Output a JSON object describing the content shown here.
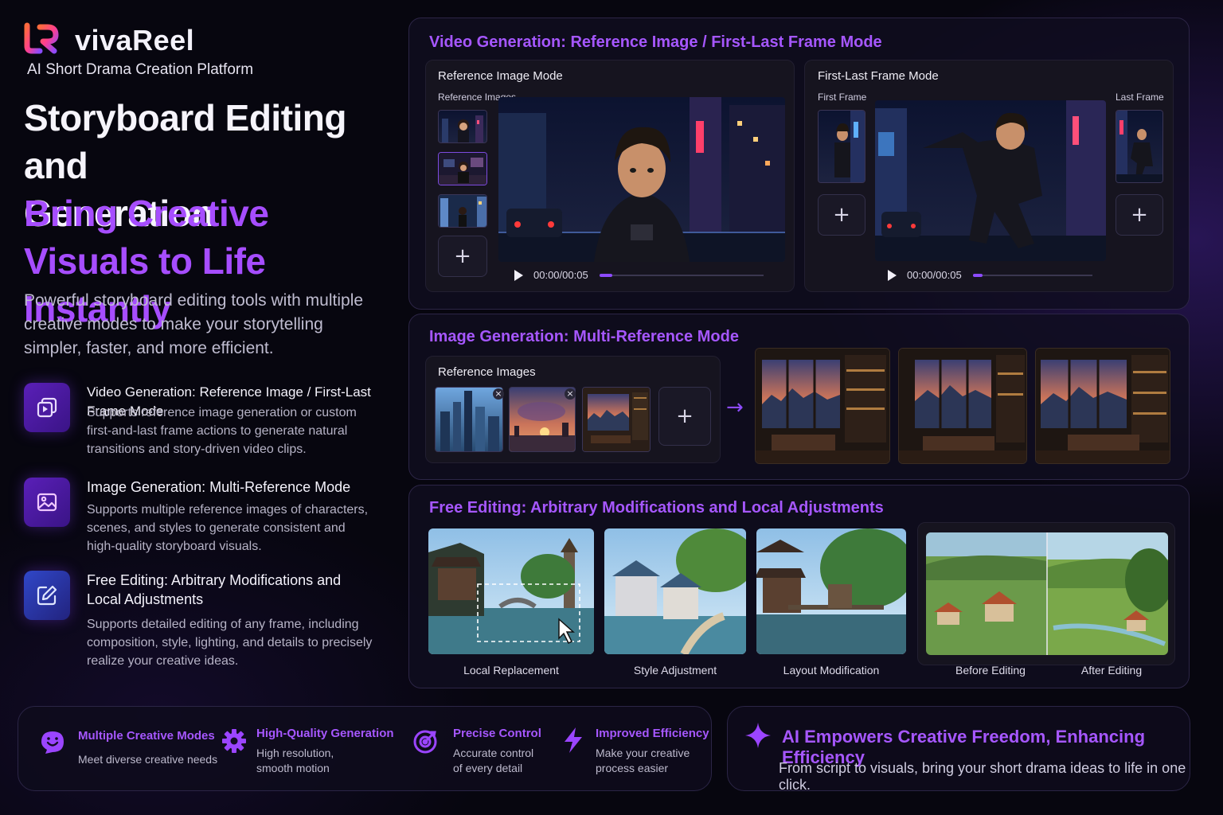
{
  "brand": {
    "name": "vivaReel",
    "tagline": "AI Short Drama Creation Platform"
  },
  "hero": {
    "title_line1": "Storyboard Editing and",
    "title_line2": "Generation",
    "accent_line1": "Bring Creative",
    "accent_line2": "Visuals to Life Instantly",
    "description": "Powerful storyboard editing tools with multiple creative modes to make your storytelling simpler, faster, and more efficient."
  },
  "features": [
    {
      "icon": "video-layers-icon",
      "title": "Video Generation: Reference Image / First-Last Frame Mode",
      "description": "Supports reference image generation or custom first-and-last frame actions to generate natural transitions and story-driven video clips."
    },
    {
      "icon": "image-icon",
      "title": "Image Generation: Multi-Reference Mode",
      "description": "Supports multiple reference images of characters, scenes, and styles to generate consistent and high-quality storyboard visuals."
    },
    {
      "icon": "edit-icon",
      "title": "Free Editing: Arbitrary Modifications and Local Adjustments",
      "description": "Supports detailed editing of any frame, including composition, style, lighting, and details to precisely realize your creative ideas."
    }
  ],
  "video_panel": {
    "title": "Video Generation: Reference Image / First-Last Frame Mode",
    "reference_mode": {
      "title": "Reference Image Mode",
      "images_label": "Reference Images",
      "time": "00:00/00:05",
      "progress": 0.08
    },
    "first_last_mode": {
      "title": "First-Last Frame Mode",
      "first_label": "First Frame",
      "last_label": "Last Frame",
      "time": "00:00/00:05",
      "progress": 0.08
    },
    "add_symbol": "+"
  },
  "image_panel": {
    "title": "Image Generation: Multi-Reference Mode",
    "reference_label": "Reference Images",
    "remove_symbol": "×",
    "add_symbol": "+",
    "arrow": "→"
  },
  "edit_panel": {
    "title": "Free Editing: Arbitrary Modifications and Local Adjustments",
    "captions": [
      "Local Replacement",
      "Style Adjustment",
      "Layout Modification"
    ],
    "before_label": "Before Editing",
    "after_label": "After Editing"
  },
  "bottom_features": [
    {
      "icon": "smile-chat-icon",
      "title": "Multiple Creative Modes",
      "line1": "Meet diverse creative needs",
      "line2": ""
    },
    {
      "icon": "gear-icon",
      "title": "High-Quality Generation",
      "line1": "High resolution,",
      "line2": "smooth motion"
    },
    {
      "icon": "target-icon",
      "title": "Precise Control",
      "line1": "Accurate control",
      "line2": "of every detail"
    },
    {
      "icon": "lightning-icon",
      "title": "Improved Efficiency",
      "line1": "Make your creative",
      "line2": "process easier"
    }
  ],
  "cta": {
    "icon": "sparkle-icon",
    "title": "AI Empowers Creative Freedom, Enhancing Efficiency",
    "description": "From script to visuals, bring your short drama ideas to life in one click."
  },
  "colors": {
    "accent": "#a657ff",
    "background": "#07060f",
    "panel": "#100d20"
  }
}
